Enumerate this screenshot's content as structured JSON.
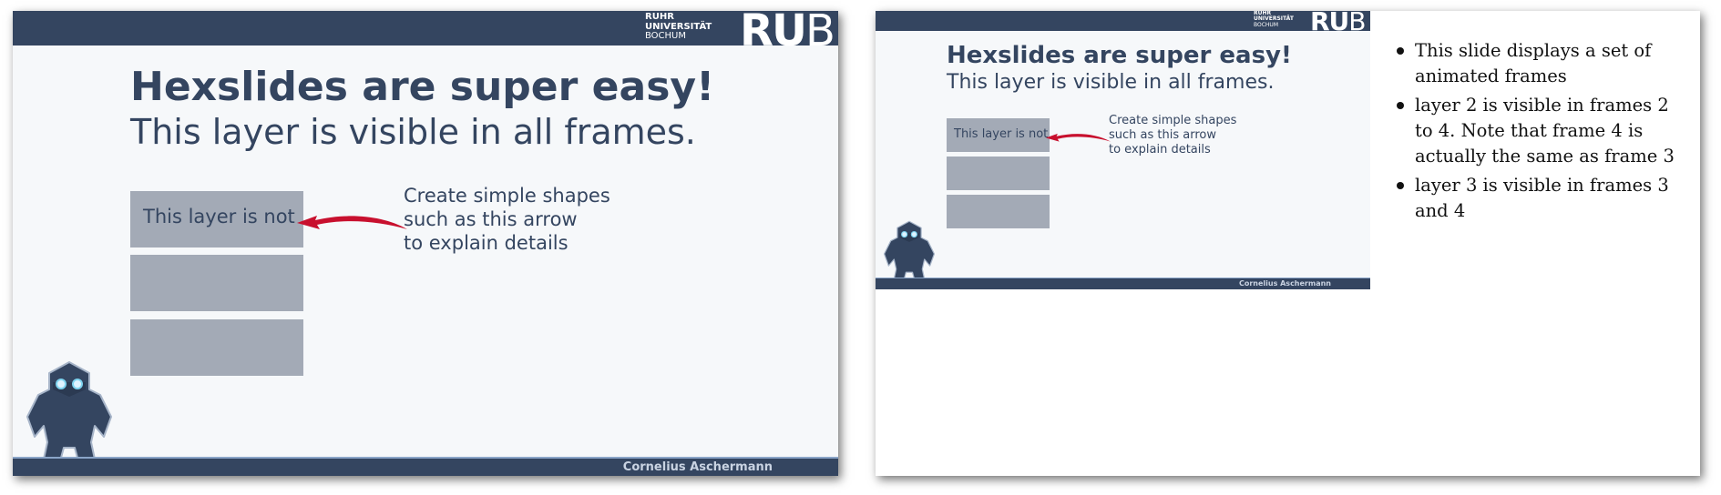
{
  "colors": {
    "slide_background": "#f6f8fa",
    "bar": "#344560",
    "text": "#344560",
    "box": "#a3aab6",
    "arrow": "#c8102e",
    "author_text": "#c9d3e2"
  },
  "branding": {
    "line1": "RUHR",
    "line2": "UNIVERSITÄT",
    "line3": "BOCHUM",
    "logo_ru": "RU",
    "logo_b": "B"
  },
  "slide": {
    "title": "Hexslides are super easy!",
    "subtitle": "This layer is visible in all frames.",
    "layer_box_label": "This layer is not",
    "annotation": {
      "line1": "Create simple shapes",
      "line2": "such as this arrow",
      "line3": "to explain details"
    },
    "author": "Cornelius Aschermann",
    "mascot_icon": "hexapod-robot-mascot-icon",
    "arrow_icon": "curved-red-arrow-icon"
  },
  "notes": [
    "This slide displays a set of animated frames",
    "layer 2 is visible in frames 2 to 4. Note that frame 4 is actually the same as frame 3",
    "layer 3 is visible in frames 3 and 4"
  ]
}
